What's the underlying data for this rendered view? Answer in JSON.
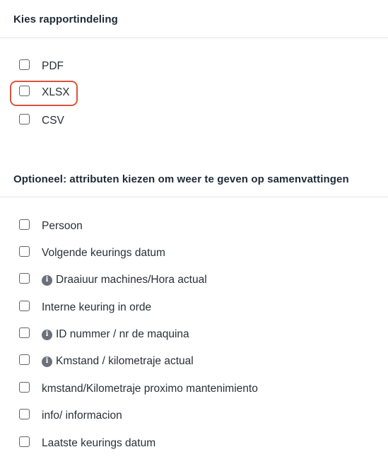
{
  "format_section": {
    "title": "Kies rapportindeling",
    "options": [
      {
        "label": "PDF",
        "checked": false
      },
      {
        "label": "XLSX",
        "checked": false,
        "highlighted": true
      },
      {
        "label": "CSV",
        "checked": false
      }
    ]
  },
  "attributes_section": {
    "title": "Optioneel: attributen kiezen om weer te geven op samenvattingen",
    "options": [
      {
        "label": "Persoon",
        "checked": false,
        "info_icon": false
      },
      {
        "label": "Volgende keurings datum",
        "checked": false,
        "info_icon": false
      },
      {
        "label": "Draaiuur machines/Hora actual",
        "checked": false,
        "info_icon": true
      },
      {
        "label": "Interne keuring in orde",
        "checked": false,
        "info_icon": false
      },
      {
        "label": "ID nummer / nr de maquina",
        "checked": false,
        "info_icon": true
      },
      {
        "label": "Kmstand / kilometraje actual",
        "checked": false,
        "info_icon": true
      },
      {
        "label": "kmstand/Kilometraje proximo mantenimiento",
        "checked": false,
        "info_icon": false
      },
      {
        "label": "info/ informacion",
        "checked": false,
        "info_icon": false
      },
      {
        "label": "Laatste keurings datum",
        "checked": false,
        "info_icon": false
      }
    ]
  },
  "info_icon_glyph": "i",
  "colors": {
    "highlight": "#d9543c",
    "divider": "#e3e6ea",
    "info_icon": "#6b7079"
  }
}
